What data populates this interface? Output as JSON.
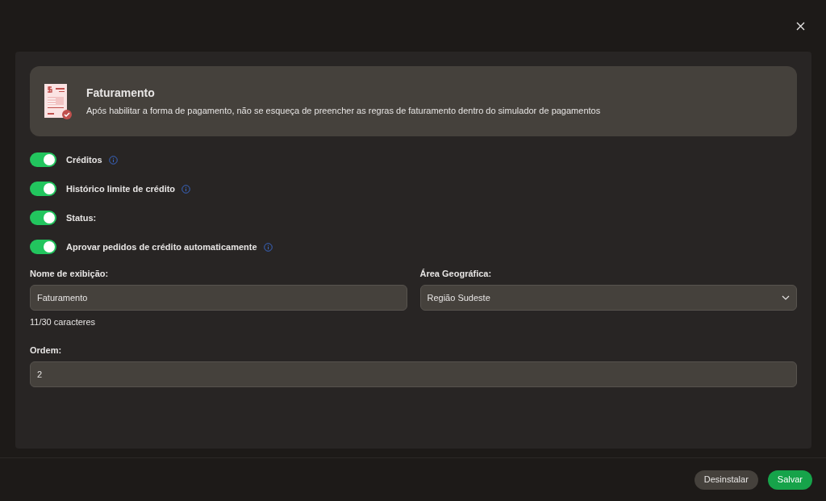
{
  "banner": {
    "title": "Faturamento",
    "description": "Após habilitar a forma de pagamento, não se esqueça de preencher as regras de faturamento dentro do simulador de pagamentos"
  },
  "toggles": [
    {
      "label": "Créditos",
      "on": true,
      "info": true
    },
    {
      "label": "Histórico limite de crédito",
      "on": true,
      "info": true
    },
    {
      "label": "Status:",
      "on": true,
      "info": false
    },
    {
      "label": "Aprovar pedidos de crédito automaticamente",
      "on": true,
      "info": true
    }
  ],
  "display_name": {
    "label": "Nome de exibição:",
    "value": "Faturamento",
    "counter": "11/30 caracteres"
  },
  "region": {
    "label": "Área Geográfica:",
    "value": "Região Sudeste"
  },
  "order": {
    "label": "Ordem:",
    "value": "2"
  },
  "buttons": [
    {
      "label": "Desinstalar",
      "kind": "secondary"
    },
    {
      "label": "Salvar",
      "kind": "primary"
    }
  ]
}
